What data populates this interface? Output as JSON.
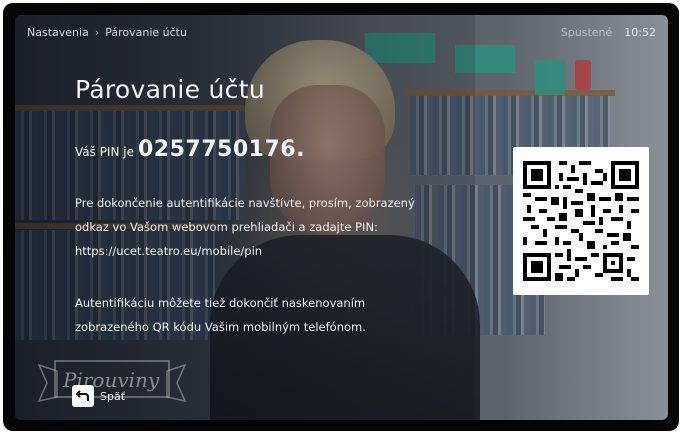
{
  "breadcrumb": {
    "items": [
      "Nastavenia",
      "Párovanie účtu"
    ],
    "separator": "›"
  },
  "status": {
    "left_text": "Spustené",
    "time": "10:52"
  },
  "title": "Párovanie účtu",
  "pin": {
    "label": "Váš PIN je",
    "value": "0257750176",
    "suffix": "."
  },
  "instructions": {
    "line1": "Pre dokončenie autentifikácie navštívte, prosím, zobrazený",
    "line2": "odkaz vo Vašom webovom prehliadači a zadajte PIN:",
    "line3": "https://ucet.teatro.eu/mobile/pin"
  },
  "qr_note": {
    "line1": "Autentifikáciu môžete tiež dokončiť naskenovaním",
    "line2": "zobrazeného QR kódu Vašim mobilným telefónom."
  },
  "logo_text": "Pirouviny",
  "back": {
    "icon": "return-arrow-icon",
    "label": "Späť"
  },
  "colors": {
    "text": "#f1f3f5",
    "bezel": "#050505",
    "qr_background": "#ffffff"
  }
}
